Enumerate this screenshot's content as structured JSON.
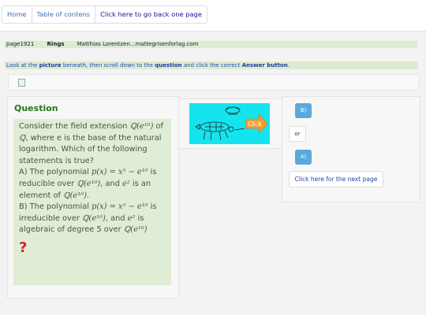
{
  "nav": {
    "home": "Home",
    "toc": "Table of contens",
    "back": "Click here to go back one page"
  },
  "info": {
    "page": "page1921",
    "topic": "Rings",
    "author": "Matthias Lorentzen...mattegrisenforlag.com"
  },
  "instructions": {
    "t1": "Look at the ",
    "b1": "picture",
    "t2": " beneath, then scroll down to the ",
    "b2": "question",
    "t3": " and click the correct ",
    "b3": "Answer button",
    "t4": "."
  },
  "question": {
    "title": "Question",
    "intro": "Consider the field extension ",
    "field": "ℚ(e¹⁰)",
    "of": " of ",
    "base": "ℚ",
    "rest": ", where e is the base of the natural logarithm. Which of the following statements is true?",
    "a_prefix": "A) The polynomial ",
    "a_poly": "p(x) = x⁵ − e¹⁰",
    "a_mid": " is reducible over ",
    "a_field": "ℚ(e¹⁰)",
    "a_and": ", and ",
    "a_e2": "e²",
    "a_end": " is an element of ",
    "a_field2": "ℚ(e¹⁰)",
    "a_dot": ".",
    "b_prefix": "B) The polynomial ",
    "b_poly": "p(x) = x⁵ − e¹⁰",
    "b_mid": " is irreducible over ",
    "b_field": "ℚ(e¹⁰)",
    "b_and": ", and ",
    "b_e2": "e²",
    "b_end": " is algebraic of degree 5 over ",
    "b_field2": "ℚ(e¹⁰)",
    "mark": "?"
  },
  "cartoon": {
    "label": "Click"
  },
  "answers": {
    "b_label": "B)",
    "or_label": "or",
    "a_label": "A)",
    "next_label": "Click here for the next page"
  },
  "colors": {
    "green_panel": "#dfedd5",
    "title_green": "#227722",
    "button_blue": "#5aa8dd",
    "question_mark": "#dd2222"
  }
}
